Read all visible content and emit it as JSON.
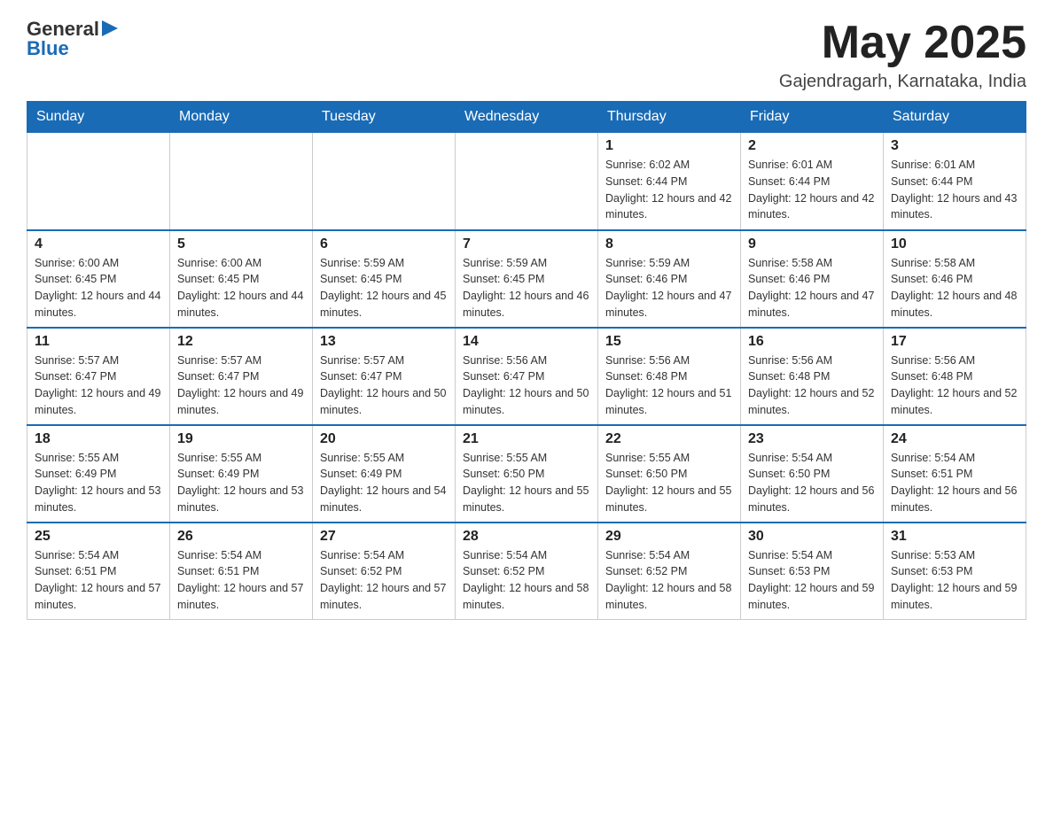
{
  "header": {
    "logo_text_general": "General",
    "logo_text_blue": "Blue",
    "month_title": "May 2025",
    "location": "Gajendragarh, Karnataka, India"
  },
  "days_of_week": [
    "Sunday",
    "Monday",
    "Tuesday",
    "Wednesday",
    "Thursday",
    "Friday",
    "Saturday"
  ],
  "weeks": [
    [
      {
        "day": "",
        "info": ""
      },
      {
        "day": "",
        "info": ""
      },
      {
        "day": "",
        "info": ""
      },
      {
        "day": "",
        "info": ""
      },
      {
        "day": "1",
        "info": "Sunrise: 6:02 AM\nSunset: 6:44 PM\nDaylight: 12 hours and 42 minutes."
      },
      {
        "day": "2",
        "info": "Sunrise: 6:01 AM\nSunset: 6:44 PM\nDaylight: 12 hours and 42 minutes."
      },
      {
        "day": "3",
        "info": "Sunrise: 6:01 AM\nSunset: 6:44 PM\nDaylight: 12 hours and 43 minutes."
      }
    ],
    [
      {
        "day": "4",
        "info": "Sunrise: 6:00 AM\nSunset: 6:45 PM\nDaylight: 12 hours and 44 minutes."
      },
      {
        "day": "5",
        "info": "Sunrise: 6:00 AM\nSunset: 6:45 PM\nDaylight: 12 hours and 44 minutes."
      },
      {
        "day": "6",
        "info": "Sunrise: 5:59 AM\nSunset: 6:45 PM\nDaylight: 12 hours and 45 minutes."
      },
      {
        "day": "7",
        "info": "Sunrise: 5:59 AM\nSunset: 6:45 PM\nDaylight: 12 hours and 46 minutes."
      },
      {
        "day": "8",
        "info": "Sunrise: 5:59 AM\nSunset: 6:46 PM\nDaylight: 12 hours and 47 minutes."
      },
      {
        "day": "9",
        "info": "Sunrise: 5:58 AM\nSunset: 6:46 PM\nDaylight: 12 hours and 47 minutes."
      },
      {
        "day": "10",
        "info": "Sunrise: 5:58 AM\nSunset: 6:46 PM\nDaylight: 12 hours and 48 minutes."
      }
    ],
    [
      {
        "day": "11",
        "info": "Sunrise: 5:57 AM\nSunset: 6:47 PM\nDaylight: 12 hours and 49 minutes."
      },
      {
        "day": "12",
        "info": "Sunrise: 5:57 AM\nSunset: 6:47 PM\nDaylight: 12 hours and 49 minutes."
      },
      {
        "day": "13",
        "info": "Sunrise: 5:57 AM\nSunset: 6:47 PM\nDaylight: 12 hours and 50 minutes."
      },
      {
        "day": "14",
        "info": "Sunrise: 5:56 AM\nSunset: 6:47 PM\nDaylight: 12 hours and 50 minutes."
      },
      {
        "day": "15",
        "info": "Sunrise: 5:56 AM\nSunset: 6:48 PM\nDaylight: 12 hours and 51 minutes."
      },
      {
        "day": "16",
        "info": "Sunrise: 5:56 AM\nSunset: 6:48 PM\nDaylight: 12 hours and 52 minutes."
      },
      {
        "day": "17",
        "info": "Sunrise: 5:56 AM\nSunset: 6:48 PM\nDaylight: 12 hours and 52 minutes."
      }
    ],
    [
      {
        "day": "18",
        "info": "Sunrise: 5:55 AM\nSunset: 6:49 PM\nDaylight: 12 hours and 53 minutes."
      },
      {
        "day": "19",
        "info": "Sunrise: 5:55 AM\nSunset: 6:49 PM\nDaylight: 12 hours and 53 minutes."
      },
      {
        "day": "20",
        "info": "Sunrise: 5:55 AM\nSunset: 6:49 PM\nDaylight: 12 hours and 54 minutes."
      },
      {
        "day": "21",
        "info": "Sunrise: 5:55 AM\nSunset: 6:50 PM\nDaylight: 12 hours and 55 minutes."
      },
      {
        "day": "22",
        "info": "Sunrise: 5:55 AM\nSunset: 6:50 PM\nDaylight: 12 hours and 55 minutes."
      },
      {
        "day": "23",
        "info": "Sunrise: 5:54 AM\nSunset: 6:50 PM\nDaylight: 12 hours and 56 minutes."
      },
      {
        "day": "24",
        "info": "Sunrise: 5:54 AM\nSunset: 6:51 PM\nDaylight: 12 hours and 56 minutes."
      }
    ],
    [
      {
        "day": "25",
        "info": "Sunrise: 5:54 AM\nSunset: 6:51 PM\nDaylight: 12 hours and 57 minutes."
      },
      {
        "day": "26",
        "info": "Sunrise: 5:54 AM\nSunset: 6:51 PM\nDaylight: 12 hours and 57 minutes."
      },
      {
        "day": "27",
        "info": "Sunrise: 5:54 AM\nSunset: 6:52 PM\nDaylight: 12 hours and 57 minutes."
      },
      {
        "day": "28",
        "info": "Sunrise: 5:54 AM\nSunset: 6:52 PM\nDaylight: 12 hours and 58 minutes."
      },
      {
        "day": "29",
        "info": "Sunrise: 5:54 AM\nSunset: 6:52 PM\nDaylight: 12 hours and 58 minutes."
      },
      {
        "day": "30",
        "info": "Sunrise: 5:54 AM\nSunset: 6:53 PM\nDaylight: 12 hours and 59 minutes."
      },
      {
        "day": "31",
        "info": "Sunrise: 5:53 AM\nSunset: 6:53 PM\nDaylight: 12 hours and 59 minutes."
      }
    ]
  ]
}
